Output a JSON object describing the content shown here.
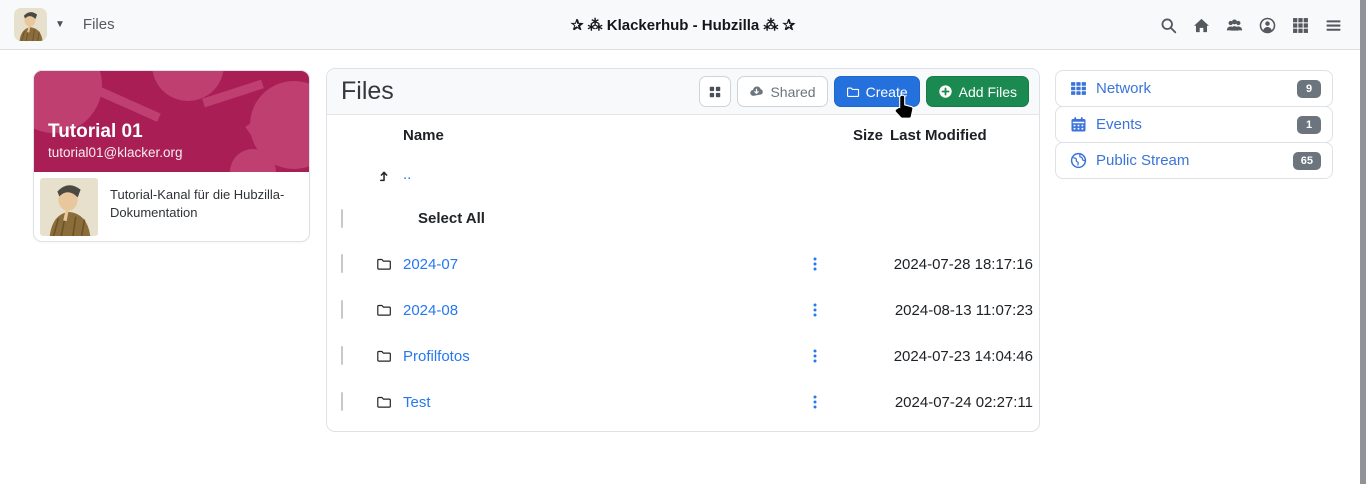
{
  "navbar": {
    "app_context_label": "Files",
    "site_title": "✰ ⁂ Klackerhub - Hubzilla ⁂ ✰",
    "icons": [
      "search-icon",
      "home-icon",
      "groups-icon",
      "account-icon",
      "apps-grid-icon",
      "menu-icon"
    ]
  },
  "profile_card": {
    "name": "Tutorial 01",
    "address": "tutorial01@klacker.org",
    "description": "Tutorial-Kanal für die Hubzilla-Dokumentation"
  },
  "files_panel": {
    "title": "Files",
    "toolbar": {
      "view_toggle_icon": "grid-view-icon",
      "shared_label": "Shared",
      "create_label": "Create",
      "add_files_label": "Add Files"
    },
    "table": {
      "col_name": "Name",
      "col_size": "Size",
      "col_modified": "Last Modified",
      "parent_link": "..",
      "select_all_label": "Select All",
      "rows": [
        {
          "name": "2024-07",
          "size": "",
          "modified": "2024-07-28 18:17:16"
        },
        {
          "name": "2024-08",
          "size": "",
          "modified": "2024-08-13 11:07:23"
        },
        {
          "name": "Profilfotos",
          "size": "",
          "modified": "2024-07-23 14:04:46"
        },
        {
          "name": "Test",
          "size": "",
          "modified": "2024-07-24 02:27:11"
        }
      ]
    }
  },
  "right_sidebar": {
    "items": [
      {
        "icon": "network-grid-icon",
        "label": "Network",
        "count": "9"
      },
      {
        "icon": "calendar-icon",
        "label": "Events",
        "count": "1"
      },
      {
        "icon": "globe-icon",
        "label": "Public Stream",
        "count": "65"
      }
    ]
  },
  "colors": {
    "banner_magenta": "#a81e55",
    "accent_blue": "#2470dd",
    "success_green": "#1b8a51",
    "link_blue": "#2678ee",
    "sidebar_link_blue": "#3b74d9",
    "badge_gray": "#6c757d"
  }
}
